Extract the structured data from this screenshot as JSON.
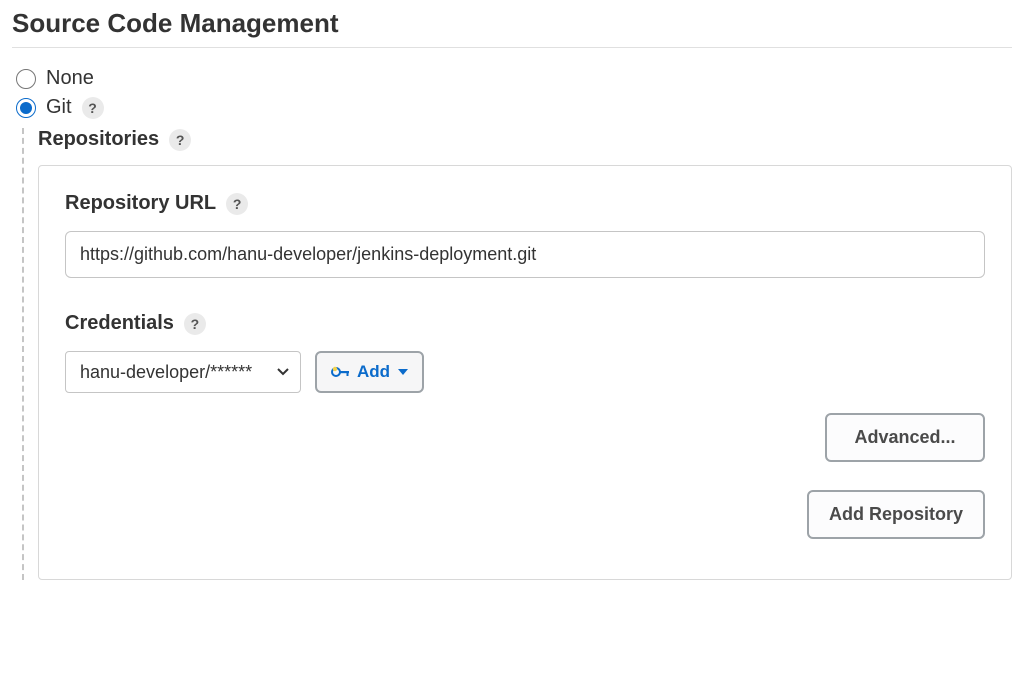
{
  "section": {
    "title": "Source Code Management"
  },
  "scm": {
    "options": {
      "none": {
        "label": "None",
        "selected": false
      },
      "git": {
        "label": "Git",
        "selected": true
      }
    },
    "repositories_label": "Repositories",
    "repo": {
      "url_label": "Repository URL",
      "url_value": "https://github.com/hanu-developer/jenkins-deployment.git",
      "credentials_label": "Credentials",
      "credentials_value": "hanu-developer/******",
      "add_label": "Add",
      "advanced_label": "Advanced...",
      "add_repo_label": "Add Repository"
    }
  },
  "help_glyph": "?"
}
